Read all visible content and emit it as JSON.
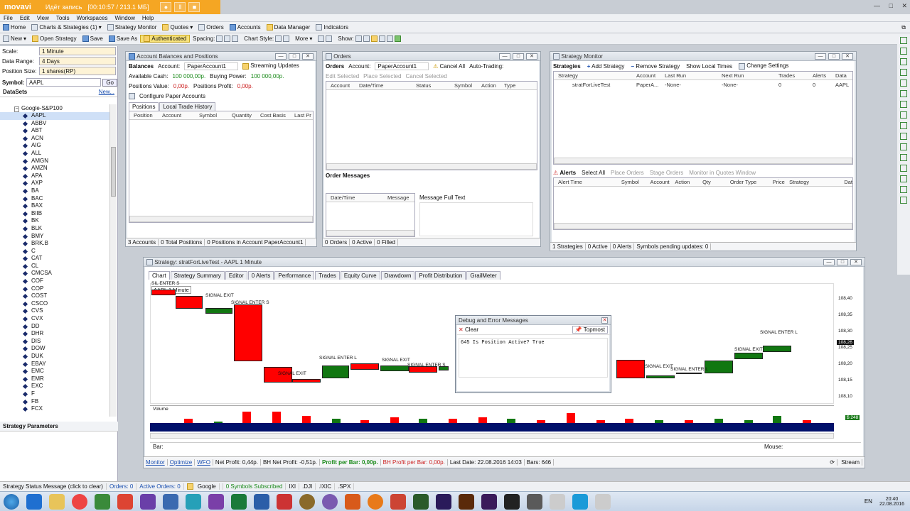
{
  "recorder": {
    "logo": "movavi",
    "status": "Идёт запись",
    "time": "[00:10:57 / 213.1 МБ]"
  },
  "menu": [
    "File",
    "Edit",
    "View",
    "Tools",
    "Workspaces",
    "Window",
    "Help"
  ],
  "toolbar1": [
    "Home",
    "Charts & Strategies (1)",
    "Strategy Monitor",
    "Quotes",
    "Orders",
    "Accounts",
    "Data Manager",
    "Indicators"
  ],
  "toolbar2": {
    "new": "New",
    "open": "Open Strategy",
    "save": "Save",
    "saveas": "Save As",
    "auth": "Authenticated",
    "spacing": "Spacing:",
    "chartstyle": "Chart Style:",
    "more": "More",
    "show": "Show:"
  },
  "left": {
    "scale_label": "Scale:",
    "scale": "1 Minute",
    "range_label": "Data Range:",
    "range": "4 Days",
    "size_label": "Position Size:",
    "size": "1 shares(RP)",
    "symbol_label": "Symbol:",
    "symbol": "AAPL",
    "go": "Go",
    "datasets": "DataSets",
    "new": "New...",
    "root": "Google-S&P100",
    "symbols": [
      "AAPL",
      "ABBV",
      "ABT",
      "ACN",
      "AIG",
      "ALL",
      "AMGN",
      "AMZN",
      "APA",
      "AXP",
      "BA",
      "BAC",
      "BAX",
      "BIIB",
      "BK",
      "BLK",
      "BMY",
      "BRK.B",
      "C",
      "CAT",
      "CL",
      "CMCSA",
      "COF",
      "COP",
      "COST",
      "CSCO",
      "CVS",
      "CVX",
      "DD",
      "DHR",
      "DIS",
      "DOW",
      "DUK",
      "EBAY",
      "EMC",
      "EMR",
      "EXC",
      "F",
      "FB",
      "FCX"
    ],
    "strategy_params": "Strategy Parameters"
  },
  "accounts": {
    "title": "Account Balances and Positions",
    "balances": "Balances",
    "account_label": "Account:",
    "account": "PaperAccount1",
    "streaming": "Streaming Updates",
    "cash_label": "Available Cash:",
    "cash": "100 000,00р.",
    "bp_label": "Buying Power:",
    "bp": "100 000,00р.",
    "pv_label": "Positions Value:",
    "pv": "0,00р.",
    "pp_label": "Positions Profit:",
    "pp": "0,00р.",
    "configure": "Configure Paper Accounts",
    "tabs": [
      "Positions",
      "Local Trade History"
    ],
    "cols": [
      "Position",
      "Account",
      "Symbol",
      "Quantity",
      "Cost Basis",
      "Last Pr"
    ],
    "status": [
      "3 Accounts",
      "0 Total Positions",
      "0 Positions in Account PaperAccount1"
    ]
  },
  "orders": {
    "title": "Orders",
    "orders": "Orders",
    "account_label": "Account:",
    "account": "PaperAccount1",
    "cancel_all": "Cancel All",
    "autotrading": "Auto-Trading:",
    "edit": "Edit Selected",
    "place": "Place Selected",
    "cancel": "Cancel Selected",
    "cols": [
      "Account",
      "Date/Time",
      "Status",
      "Symbol",
      "Action",
      "Type"
    ],
    "messages": "Order Messages",
    "msg_cols": [
      "Date/Time",
      "Message"
    ],
    "full_text": "Message Full Text",
    "status": [
      "0 Orders",
      "0 Active",
      "0 Filled"
    ]
  },
  "monitor": {
    "title": "Strategy Monitor",
    "strategies": "Strategies",
    "add": "Add Strategy",
    "remove": "Remove Strategy",
    "show_local": "Show Local Times",
    "change": "Change Settings",
    "cols": [
      "Strategy",
      "Account",
      "Last Run",
      "Next Run",
      "Trades",
      "Alerts",
      "Data"
    ],
    "row": [
      "stratForLiveTest",
      "PaperA...",
      "-None-",
      "-None-",
      "0",
      "0",
      "AAPL"
    ],
    "alerts": "Alerts",
    "select_all": "Select All",
    "place_orders": "Place Orders",
    "stage_orders": "Stage Orders",
    "monitor_quotes": "Monitor in Quotes Window",
    "alert_cols": [
      "Alert Time",
      "Symbol",
      "Account",
      "Action",
      "Qty",
      "Order Type",
      "Price",
      "Strategy",
      "Dat"
    ],
    "status": [
      "1 Strategies",
      "0 Active",
      "0 Alerts",
      "Symbols pending updates: 0"
    ]
  },
  "chart": {
    "title": "Strategy: stratForLiveTest - AAPL 1 Minute",
    "tabs": [
      "Chart",
      "Strategy Summary",
      "Editor",
      "0 Alerts",
      "Performance",
      "Trades",
      "Equity Curve",
      "Drawdown",
      "Profit Distribution",
      "GrailMeter"
    ],
    "label": "AAPL 1 Minute",
    "enter_top": "SIL ENTER S",
    "yticks": [
      "108,40",
      "108,35",
      "108,30",
      "108,25",
      "108,20",
      "108,15",
      "108,10"
    ],
    "price_flag": "108,26",
    "vol_flag": "$ 248",
    "volume": "Volume",
    "signals": [
      "SIGNAL EXIT",
      "SIGNAL ENTER S",
      "SIGNAL EXIT",
      "SIGNAL ENTER L",
      "SIGNAL EXIT",
      "SIGNAL ENTER S",
      "SIGNAL EXIT",
      "SIGNAL ENTER L",
      "SIGNAL EXIT",
      "SIGNAL ENTER L"
    ],
    "bar_label": "Bar:",
    "mouse_label": "Mouse:",
    "status": {
      "monitor": "Monitor",
      "optimize": "Optimize",
      "wfo": "WFO",
      "net": "Net Profit: 0,44р.",
      "bh": "BH Net Profit: -0,51р.",
      "ppb": "Profit per Bar: 0,00р.",
      "bhppb": "BH Profit per Bar: 0,00р.",
      "last": "Last Date: 22.08.2016 14:03",
      "bars": "Bars: 646",
      "stream": "Stream"
    }
  },
  "debug": {
    "title": "Debug and Error Messages",
    "clear": "Clear",
    "topmost": "Topmost",
    "msg": "645 Is Position Active? True"
  },
  "statusline": [
    "Strategy Status Message (click to clear)",
    "Orders: 0",
    "Active Orders: 0",
    "Google",
    "0 Symbols Subscribed",
    "IXI",
    ".DJI",
    ".IXIC",
    ".SPX"
  ],
  "taskbar": {
    "lang": "EN",
    "time": "20:40",
    "date": "22.08.2016"
  },
  "colors": {
    "up": "#117711",
    "down": "#ff0000",
    "volband": "#00106a"
  }
}
